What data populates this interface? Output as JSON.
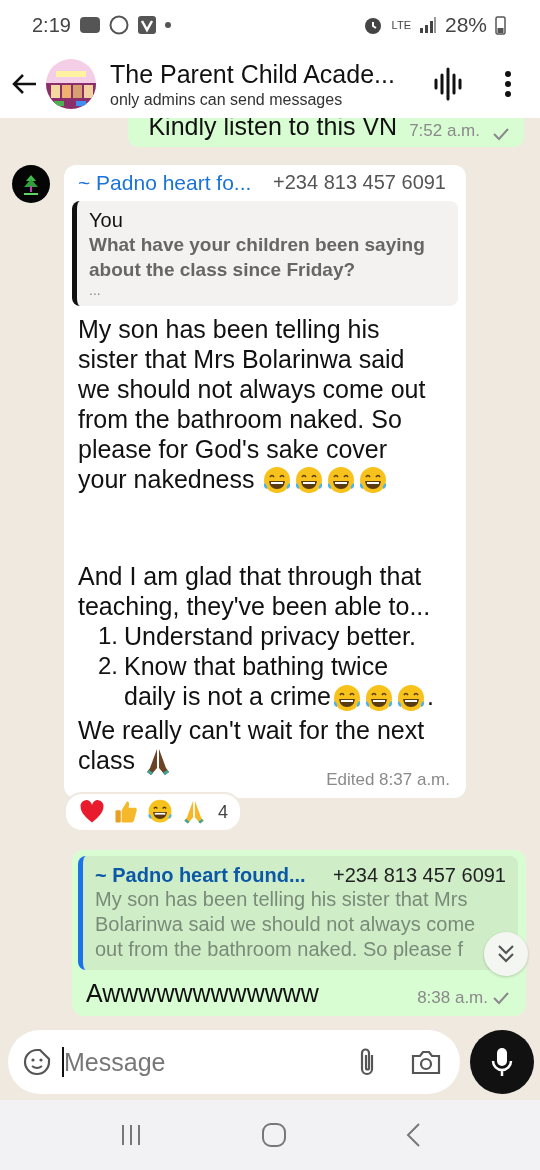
{
  "status_bar": {
    "time": "2:19",
    "network": "LTE",
    "battery": "28%"
  },
  "header": {
    "title": "The Parent Child Acade...",
    "subtitle": "only admins can send messages"
  },
  "messages": [
    {
      "kind": "outgoing_partial",
      "text": "Kindly listen to this VN",
      "time": "7:52 a.m."
    },
    {
      "kind": "incoming",
      "sender": "~ Padno heart fo...",
      "phone": "+234 813 457 6091",
      "reply": {
        "author": "You",
        "text": "What have your children been saying about the class since Friday?",
        "more": "..."
      },
      "blocks": [
        {
          "kind": "para",
          "text": "My son has been telling his sister that Mrs Bolarinwa said we should not always come out from the bathroom naked. So please for God's sake cover your nakedness",
          "emoji": [
            {
              "kind": "laugh"
            },
            {
              "kind": "laugh"
            },
            {
              "kind": "laugh"
            },
            {
              "kind": "laugh"
            }
          ]
        },
        {
          "kind": "para",
          "text": "And I am glad that through that teaching, they've been able to..."
        },
        {
          "kind": "list_item",
          "number": "1.",
          "text": "Understand privacy better."
        },
        {
          "kind": "list_item",
          "number": "2.",
          "text": "Know that bathing twice daily is not a crime",
          "emoji": [
            {
              "kind": "laugh"
            },
            {
              "kind": "laugh"
            },
            {
              "kind": "laugh"
            }
          ],
          "suffix": "."
        },
        {
          "kind": "para",
          "text": "We really can't wait for the next class",
          "emoji": [
            {
              "kind": "pray_dark"
            }
          ]
        }
      ],
      "meta": "Edited 8:37 a.m.",
      "reactions": {
        "emoji": [
          {
            "kind": "heart"
          },
          {
            "kind": "thumbs_up"
          },
          {
            "kind": "laugh"
          },
          {
            "kind": "pray"
          }
        ],
        "count": "4"
      }
    },
    {
      "kind": "outgoing",
      "reply": {
        "author": "~ Padno heart found...",
        "phone": "+234 813 457 6091",
        "text": "My son has been telling his sister that Mrs Bolarinwa said we should not always come out from the bathroom naked. So please f"
      },
      "text": "Awwwwwwwwwwww",
      "time": "8:38 a.m."
    }
  ],
  "composer": {
    "placeholder": "Message"
  }
}
